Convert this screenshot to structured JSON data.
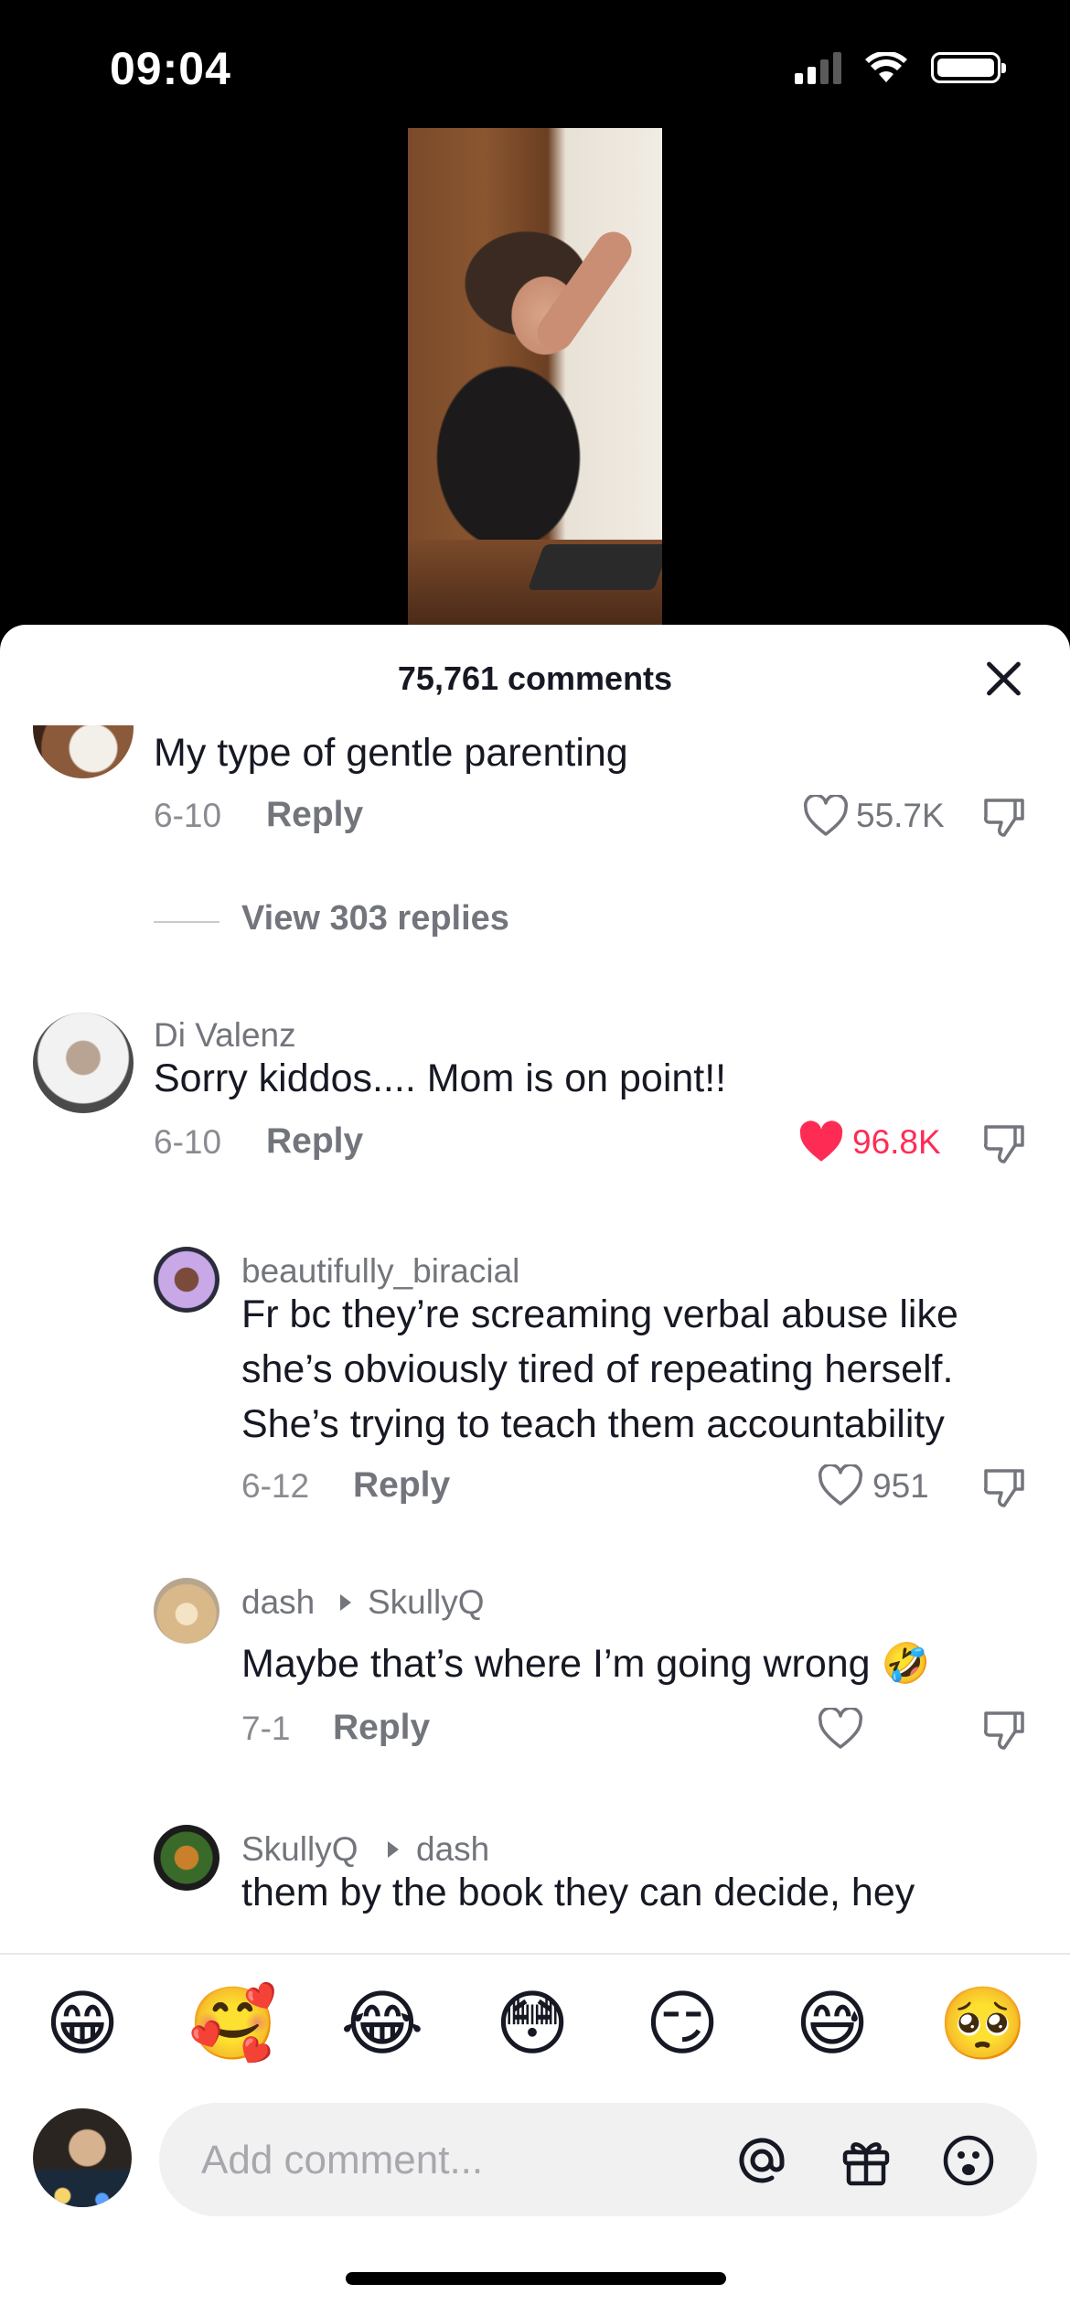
{
  "status_bar": {
    "time": "09:04",
    "signal_icon": "cellular-signal-icon",
    "wifi_icon": "wifi-icon",
    "battery_icon": "battery-icon"
  },
  "video": {
    "description_icon": "video-thumbnail"
  },
  "comments_sheet": {
    "title": "75,761 comments",
    "close_icon": "close-icon"
  },
  "comments": [
    {
      "username": "",
      "text": "My type of gentle parenting",
      "date": "6-10",
      "reply_label": "Reply",
      "likes": "55.7K",
      "liked": false,
      "view_replies": "View 303 replies"
    },
    {
      "username": "Di Valenz",
      "text": "Sorry kiddos.... Mom is on point!!",
      "date": "6-10",
      "reply_label": "Reply",
      "likes": "96.8K",
      "liked": true
    }
  ],
  "replies": [
    {
      "username": "beautifully_biracial",
      "text_lines": [
        "Fr bc they’re screaming verbal abuse like",
        "she’s obviously tired of repeating herself.",
        "She’s trying to teach them accountability"
      ],
      "date": "6-12",
      "reply_label": "Reply",
      "likes": "951",
      "liked": false
    },
    {
      "username": "dash",
      "reply_to": "SkullyQ",
      "text": "Maybe that’s where I’m going wrong 🤣",
      "date": "7-1",
      "reply_label": "Reply",
      "likes": "",
      "liked": false
    },
    {
      "username": "SkullyQ",
      "reply_to": "dash",
      "text": "them by the book they can decide, hey"
    }
  ],
  "quick_emojis": [
    "😁",
    "🥰",
    "😂",
    "😳",
    "😏",
    "😅",
    "🥺"
  ],
  "comment_input": {
    "placeholder": "Add comment...",
    "mention_icon": "at-mention-icon",
    "gift_icon": "gift-icon",
    "emoji_icon": "emoji-icon"
  },
  "colors": {
    "accent_like": "#fe2c55",
    "text_primary": "#161823",
    "text_secondary": "#73757c"
  }
}
